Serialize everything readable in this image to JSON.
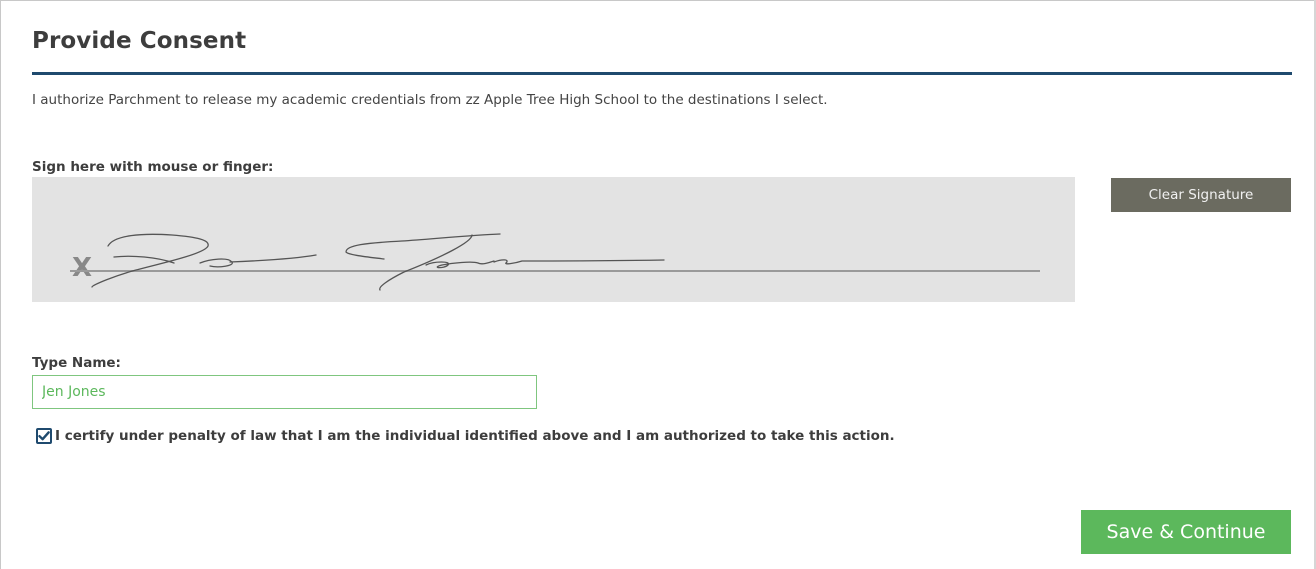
{
  "page": {
    "title": "Provide Consent",
    "consent_text": "I authorize Parchment to release my academic credentials from zz Apple Tree High School to the destinations I select."
  },
  "signature": {
    "label": "Sign here with mouse or finger:",
    "x_mark": "X",
    "clear_label": "Clear Signature"
  },
  "name_field": {
    "label": "Type Name:",
    "value": "Jen Jones"
  },
  "certification": {
    "checked": true,
    "text": "I certify under penalty of law that I am the individual identified above and I am authorized to take this action."
  },
  "actions": {
    "save_label": "Save & Continue"
  },
  "colors": {
    "title_rule": "#1f4a6e",
    "signature_pad": "#e3e3e3",
    "clear_button": "#6b6b60",
    "save_button": "#5cb85c",
    "input_border": "#7fc67f",
    "input_text": "#5cb85c"
  }
}
